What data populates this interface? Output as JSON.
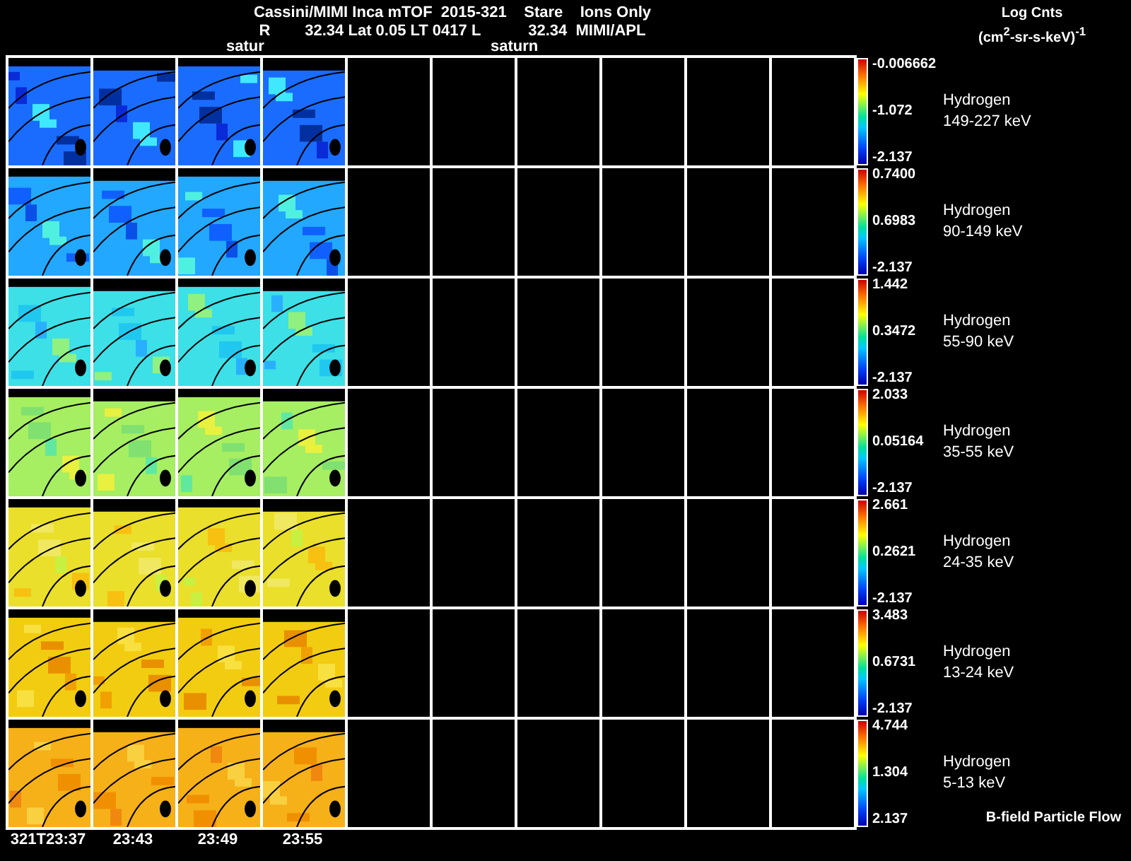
{
  "header": {
    "title": "Cassini/MIMI Inca mTOF  2015-321    Stare    Ions Only",
    "subtitle": "R        32.34 Lat 0.05 LT 0417 L           32.34  MIMI/APL",
    "overlay_labels": [
      "satur",
      "saturn"
    ],
    "units_title": "Log Cnts",
    "units": "(cm$^{2}$-sr-s-keV)$^{-1}$"
  },
  "rows": [
    {
      "species": "Hydrogen",
      "energy": "149-227 keV",
      "max": "-0.006662",
      "mid": "-1.072",
      "min": "-2.137"
    },
    {
      "species": "Hydrogen",
      "energy": "90-149 keV",
      "max": "0.7400",
      "mid": "0.6983",
      "min": "-2.137"
    },
    {
      "species": "Hydrogen",
      "energy": "55-90 keV",
      "max": "1.442",
      "mid": "0.3472",
      "min": "-2.137"
    },
    {
      "species": "Hydrogen",
      "energy": "35-55 keV",
      "max": "2.033",
      "mid": "0.05164",
      "min": "-2.137"
    },
    {
      "species": "Hydrogen",
      "energy": "24-35 keV",
      "max": "2.661",
      "mid": "0.2621",
      "min": "-2.137"
    },
    {
      "species": "Hydrogen",
      "energy": "13-24 keV",
      "max": "3.483",
      "mid": "0.6731",
      "min": "-2.137"
    },
    {
      "species": "Hydrogen",
      "energy": "5-13 keV",
      "max": "4.744",
      "mid": "1.304",
      "min": "2.137"
    }
  ],
  "times": [
    "321T23:37",
    "23:43",
    "23:49",
    "23:55"
  ],
  "footer": "B-field Particle Flow"
}
